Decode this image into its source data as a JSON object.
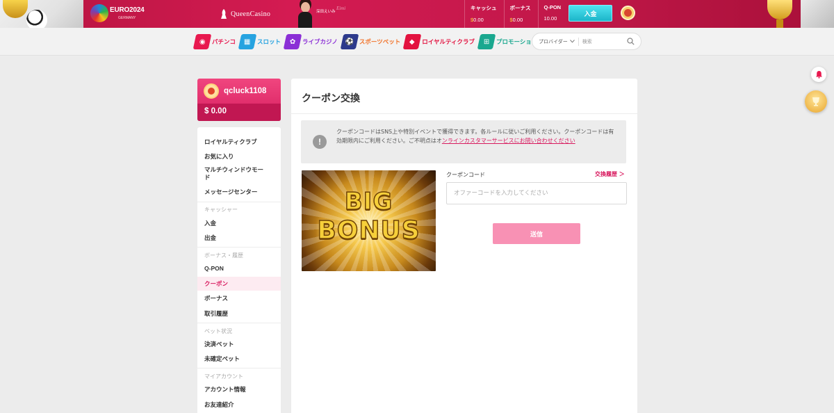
{
  "header": {
    "euro_logo_title": "EURO2024",
    "euro_logo_sub": "GERMANY",
    "brand": "QueenCasino",
    "ambassador_name": "深田えいみ",
    "ambassador_signature": "Eimi",
    "balances": [
      {
        "label": "キャッシュ",
        "currency": "$",
        "value": "0.00"
      },
      {
        "label": "ボーナス",
        "currency": "$",
        "value": "0.00"
      },
      {
        "label": "Q-PON",
        "currency": "",
        "value": "10.00"
      }
    ],
    "deposit_label": "入金"
  },
  "nav": {
    "items": [
      {
        "label": "パチンコ",
        "color": "#e8194f",
        "icon": "pachinko-icon",
        "glyph": "◉"
      },
      {
        "label": "スロット",
        "color": "#26a3e0",
        "icon": "slot-icon",
        "glyph": "▦"
      },
      {
        "label": "ライブカジノ",
        "color": "#8b2fd6",
        "icon": "live-casino-icon",
        "glyph": "✿"
      },
      {
        "label": "スポーツベット",
        "color": "#f2732a",
        "icon": "sports-icon",
        "glyph": "⚽"
      },
      {
        "label": "ロイヤルティクラブ",
        "color": "#e3123f",
        "icon": "diamond-icon",
        "glyph": "◆"
      },
      {
        "label": "プロモーション",
        "color": "#1aa88f",
        "icon": "gift-icon",
        "glyph": "⊞"
      }
    ],
    "provider_label": "プロバイダー",
    "search_placeholder": "検索"
  },
  "user": {
    "username": "qcluck1108",
    "balance": "$ 0.00"
  },
  "sidebar": {
    "loyalty": "ロイヤルティクラブ",
    "favorites": "お気に入り",
    "multiwindow_line1": "マルチウィンドウモー",
    "multiwindow_line2": "ド",
    "message_center": "メッセージセンター",
    "cashier_head": "キャッシャー",
    "deposit": "入金",
    "withdraw": "出金",
    "bonus_head": "ボーナス・履歴",
    "qpon": "Q-PON",
    "coupon": "クーポン",
    "bonus": "ボーナス",
    "transactions": "取引履歴",
    "bet_head": "ベット状況",
    "settled": "決済ベット",
    "unsettled": "未確定ベット",
    "account_head": "マイアカウント",
    "account_info": "アカウント情報",
    "referral": "お友達紹介"
  },
  "main": {
    "title": "クーポン交換",
    "notice_text": "クーポンコードはSNS上や特別イベントで獲得できます。各ルールに従いご利用ください。クーポンコードは有効期限内にご利用ください。ご不明点はオ",
    "notice_link": "ンラインカスタマーサービスにお問い合わせください",
    "banner_word1": "BIG",
    "banner_word2": "BONUS",
    "coupon_label": "クーポンコード",
    "history_link": "交換履歴 ＞",
    "coupon_placeholder": "オファーコードを入力してください",
    "coupon_value": "",
    "submit_label": "送信"
  }
}
